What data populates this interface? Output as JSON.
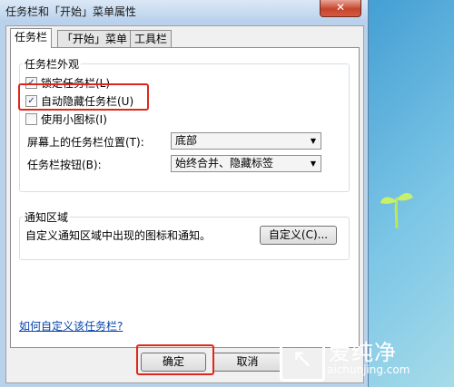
{
  "window": {
    "title": "任务栏和「开始」菜单属性",
    "close_glyph": "✕"
  },
  "tabs": [
    {
      "label": "任务栏",
      "active": true
    },
    {
      "label": "「开始」菜单",
      "active": false
    },
    {
      "label": "工具栏",
      "active": false
    }
  ],
  "appearance": {
    "group_label": "任务栏外观",
    "lock": {
      "label": "锁定任务栏(L)",
      "checked": true
    },
    "autohide": {
      "label": "自动隐藏任务栏(U)",
      "checked": true
    },
    "small_icons": {
      "label": "使用小图标(I)",
      "checked": false
    },
    "position": {
      "label": "屏幕上的任务栏位置(T):",
      "value": "底部"
    },
    "buttons": {
      "label": "任务栏按钮(B):",
      "value": "始终合并、隐藏标签"
    }
  },
  "notification": {
    "group_label": "通知区域",
    "description": "自定义通知区域中出现的图标和通知。",
    "customize_label": "自定义(C)..."
  },
  "help_link": "如何自定义该任务栏?",
  "footer": {
    "ok_label": "确定",
    "cancel_label": "取消"
  },
  "watermark": {
    "chinese": "爱纯净",
    "url": "aichunjing.com",
    "mark": "↖"
  },
  "checkmark": "✓",
  "dropdown_arrow": "▼",
  "colors": {
    "highlight": "#e0261b",
    "link": "#0645ad"
  }
}
